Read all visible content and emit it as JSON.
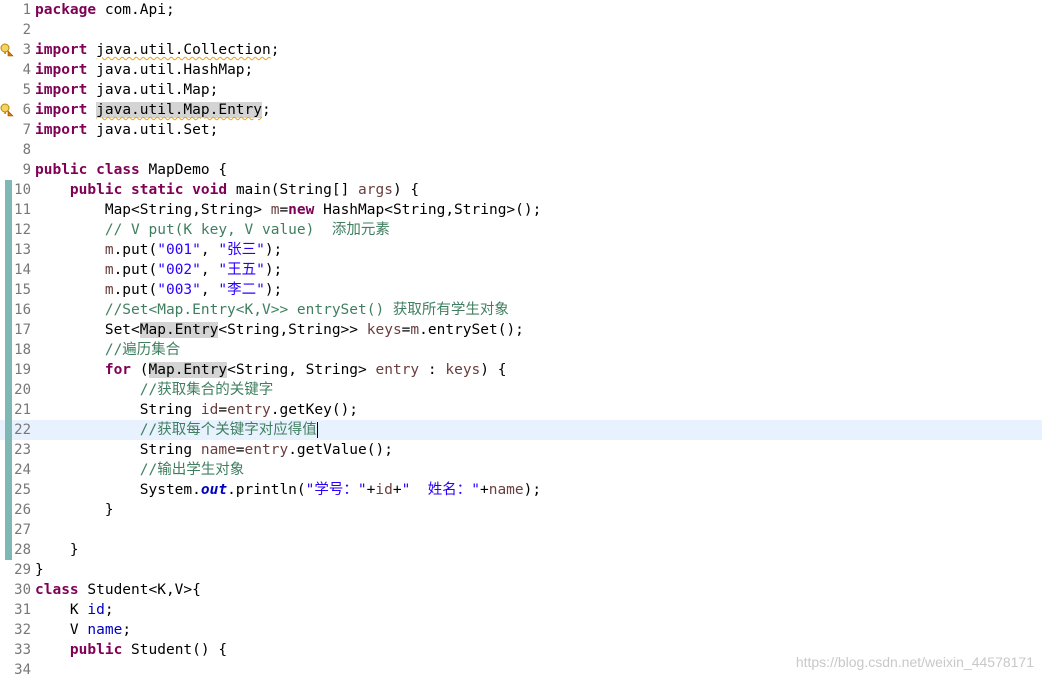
{
  "editor": {
    "lines": [
      {
        "num": "1",
        "tokens": [
          {
            "t": "package",
            "c": "kw"
          },
          {
            "t": " com.Api;"
          }
        ]
      },
      {
        "num": "2",
        "tokens": []
      },
      {
        "num": "3",
        "marker": "warning",
        "tokens": [
          {
            "t": "import",
            "c": "kw"
          },
          {
            "t": " "
          },
          {
            "t": "java.util.Collection",
            "c": "warn"
          },
          {
            "t": ";"
          }
        ]
      },
      {
        "num": "4",
        "tokens": [
          {
            "t": "import",
            "c": "kw"
          },
          {
            "t": " java.util.HashMap;"
          }
        ]
      },
      {
        "num": "5",
        "tokens": [
          {
            "t": "import",
            "c": "kw"
          },
          {
            "t": " java.util.Map;"
          }
        ]
      },
      {
        "num": "6",
        "marker": "warning",
        "tokens": [
          {
            "t": "import",
            "c": "kw"
          },
          {
            "t": " "
          },
          {
            "t": "java.util.Map.Entry",
            "c": "hl warn"
          },
          {
            "t": ";"
          }
        ]
      },
      {
        "num": "7",
        "tokens": [
          {
            "t": "import",
            "c": "kw"
          },
          {
            "t": " java.util.Set;"
          }
        ]
      },
      {
        "num": "8",
        "tokens": []
      },
      {
        "num": "9",
        "tokens": [
          {
            "t": "public",
            "c": "kw"
          },
          {
            "t": " "
          },
          {
            "t": "class",
            "c": "kw"
          },
          {
            "t": " MapDemo {"
          }
        ]
      },
      {
        "num": "10",
        "changed": true,
        "tokens": [
          {
            "t": "    "
          },
          {
            "t": "public",
            "c": "kw"
          },
          {
            "t": " "
          },
          {
            "t": "static",
            "c": "kw"
          },
          {
            "t": " "
          },
          {
            "t": "void",
            "c": "kw"
          },
          {
            "t": " main(String[] "
          },
          {
            "t": "args",
            "c": "var"
          },
          {
            "t": ") {"
          }
        ]
      },
      {
        "num": "11",
        "changed": true,
        "tokens": [
          {
            "t": "        Map<String,String> "
          },
          {
            "t": "m",
            "c": "var"
          },
          {
            "t": "="
          },
          {
            "t": "new",
            "c": "kw"
          },
          {
            "t": " HashMap<String,String>();"
          }
        ]
      },
      {
        "num": "12",
        "changed": true,
        "tokens": [
          {
            "t": "        "
          },
          {
            "t": "// V put(K key, V value)  添加元素",
            "c": "cm"
          }
        ]
      },
      {
        "num": "13",
        "changed": true,
        "tokens": [
          {
            "t": "        "
          },
          {
            "t": "m",
            "c": "var"
          },
          {
            "t": ".put("
          },
          {
            "t": "\"001\"",
            "c": "str"
          },
          {
            "t": ", "
          },
          {
            "t": "\"张三\"",
            "c": "str"
          },
          {
            "t": ");"
          }
        ]
      },
      {
        "num": "14",
        "changed": true,
        "tokens": [
          {
            "t": "        "
          },
          {
            "t": "m",
            "c": "var"
          },
          {
            "t": ".put("
          },
          {
            "t": "\"002\"",
            "c": "str"
          },
          {
            "t": ", "
          },
          {
            "t": "\"王五\"",
            "c": "str"
          },
          {
            "t": ");"
          }
        ]
      },
      {
        "num": "15",
        "changed": true,
        "tokens": [
          {
            "t": "        "
          },
          {
            "t": "m",
            "c": "var"
          },
          {
            "t": ".put("
          },
          {
            "t": "\"003\"",
            "c": "str"
          },
          {
            "t": ", "
          },
          {
            "t": "\"李二\"",
            "c": "str"
          },
          {
            "t": ");"
          }
        ]
      },
      {
        "num": "16",
        "changed": true,
        "tokens": [
          {
            "t": "        "
          },
          {
            "t": "//Set<Map.Entry<K,V>> entrySet() 获取所有学生对象",
            "c": "cm"
          }
        ]
      },
      {
        "num": "17",
        "changed": true,
        "tokens": [
          {
            "t": "        Set<"
          },
          {
            "t": "Map.Entry",
            "c": "hl"
          },
          {
            "t": "<String,String>> "
          },
          {
            "t": "keys",
            "c": "var"
          },
          {
            "t": "="
          },
          {
            "t": "m",
            "c": "var"
          },
          {
            "t": ".entrySet();"
          }
        ]
      },
      {
        "num": "18",
        "changed": true,
        "tokens": [
          {
            "t": "        "
          },
          {
            "t": "//遍历集合",
            "c": "cm"
          }
        ]
      },
      {
        "num": "19",
        "changed": true,
        "tokens": [
          {
            "t": "        "
          },
          {
            "t": "for",
            "c": "kw"
          },
          {
            "t": " ("
          },
          {
            "t": "Map.Entry",
            "c": "hl"
          },
          {
            "t": "<String, String> "
          },
          {
            "t": "entry",
            "c": "var"
          },
          {
            "t": " : "
          },
          {
            "t": "keys",
            "c": "var"
          },
          {
            "t": ") {"
          }
        ]
      },
      {
        "num": "20",
        "changed": true,
        "tokens": [
          {
            "t": "            "
          },
          {
            "t": "//获取集合的关键字",
            "c": "cm"
          }
        ]
      },
      {
        "num": "21",
        "changed": true,
        "tokens": [
          {
            "t": "            String "
          },
          {
            "t": "id",
            "c": "var"
          },
          {
            "t": "="
          },
          {
            "t": "entry",
            "c": "var"
          },
          {
            "t": ".getKey();"
          }
        ]
      },
      {
        "num": "22",
        "changed": true,
        "current": true,
        "tokens": [
          {
            "t": "            "
          },
          {
            "t": "//获取每个关键字对应得值",
            "c": "cm"
          },
          {
            "t": "",
            "c": "caret"
          }
        ]
      },
      {
        "num": "23",
        "changed": true,
        "tokens": [
          {
            "t": "            String "
          },
          {
            "t": "name",
            "c": "var"
          },
          {
            "t": "="
          },
          {
            "t": "entry",
            "c": "var"
          },
          {
            "t": ".getValue();"
          }
        ]
      },
      {
        "num": "24",
        "changed": true,
        "tokens": [
          {
            "t": "            "
          },
          {
            "t": "//输出学生对象",
            "c": "cm"
          }
        ]
      },
      {
        "num": "25",
        "changed": true,
        "tokens": [
          {
            "t": "            System."
          },
          {
            "t": "out",
            "c": "fld"
          },
          {
            "t": ".println("
          },
          {
            "t": "\"学号：\"",
            "c": "str"
          },
          {
            "t": "+"
          },
          {
            "t": "id",
            "c": "var"
          },
          {
            "t": "+"
          },
          {
            "t": "\"  姓名：\"",
            "c": "str"
          },
          {
            "t": "+"
          },
          {
            "t": "name",
            "c": "var"
          },
          {
            "t": ");"
          }
        ]
      },
      {
        "num": "26",
        "changed": true,
        "tokens": [
          {
            "t": "        }"
          }
        ]
      },
      {
        "num": "27",
        "changed": true,
        "tokens": []
      },
      {
        "num": "28",
        "changed": true,
        "tokens": [
          {
            "t": "    }"
          }
        ]
      },
      {
        "num": "29",
        "tokens": [
          {
            "t": "}"
          }
        ]
      },
      {
        "num": "30",
        "tokens": [
          {
            "t": "class",
            "c": "kw"
          },
          {
            "t": " Student<K,V>{"
          }
        ]
      },
      {
        "num": "31",
        "tokens": [
          {
            "t": "    K "
          },
          {
            "t": "id",
            "c": "fldn"
          },
          {
            "t": ";"
          }
        ]
      },
      {
        "num": "32",
        "tokens": [
          {
            "t": "    V "
          },
          {
            "t": "name",
            "c": "fldn"
          },
          {
            "t": ";"
          }
        ]
      },
      {
        "num": "33",
        "tokens": [
          {
            "t": "    "
          },
          {
            "t": "public",
            "c": "kw"
          },
          {
            "t": " Student() {"
          }
        ]
      },
      {
        "num": "34",
        "tokens": []
      }
    ]
  },
  "watermark": "https://blog.csdn.net/weixin_44578171",
  "colors": {
    "keyword": "#7f0055",
    "comment": "#3f7f5f",
    "string": "#2a00ff",
    "local_variable": "#6a3e3e",
    "field": "#0000c0",
    "current_line": "#e8f2fe",
    "change_ruler": "#7fb7b5"
  }
}
